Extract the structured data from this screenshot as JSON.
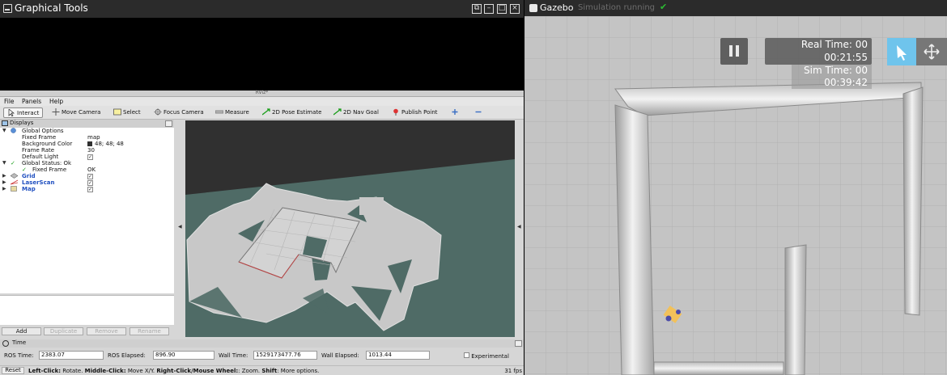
{
  "left_window": {
    "title": "Graphical Tools",
    "controls": {
      "restore": "⧉",
      "minimize": "–",
      "maximize": "□",
      "close": "×"
    }
  },
  "rviz": {
    "title": "RViz*",
    "menu": [
      "File",
      "Panels",
      "Help"
    ],
    "toolbar": [
      {
        "label": "Interact",
        "icon": "cursor-icon"
      },
      {
        "label": "Move Camera",
        "icon": "move-camera-icon"
      },
      {
        "label": "Select",
        "icon": "select-icon"
      },
      {
        "label": "Focus Camera",
        "icon": "focus-icon"
      },
      {
        "label": "Measure",
        "icon": "ruler-icon"
      },
      {
        "label": "2D Pose Estimate",
        "icon": "green-arrow-icon"
      },
      {
        "label": "2D Nav Goal",
        "icon": "green-arrow-icon"
      },
      {
        "label": "Publish Point",
        "icon": "pin-icon"
      }
    ],
    "displays": {
      "header": "Displays",
      "rows": {
        "global_options": "Global Options",
        "fixed_frame_key": "Fixed Frame",
        "fixed_frame_val": "map",
        "bg_color_key": "Background Color",
        "bg_color_val": "48; 48; 48",
        "frame_rate_key": "Frame Rate",
        "frame_rate_val": "30",
        "default_light_key": "Default Light",
        "global_status": "Global Status: Ok",
        "status_fixed_frame_key": "Fixed Frame",
        "status_fixed_frame_val": "OK",
        "grid": "Grid",
        "laserscan": "LaserScan",
        "map": "Map"
      },
      "buttons": {
        "add": "Add",
        "duplicate": "Duplicate",
        "remove": "Remove",
        "rename": "Rename"
      }
    },
    "time": {
      "header": "Time",
      "ros_time_label": "ROS Time:",
      "ros_time": "2383.07",
      "ros_elapsed_label": "ROS Elapsed:",
      "ros_elapsed": "896.90",
      "wall_time_label": "Wall Time:",
      "wall_time": "1529173477.76",
      "wall_elapsed_label": "Wall Elapsed:",
      "wall_elapsed": "1013.44",
      "experimental": "Experimental"
    },
    "status": {
      "reset": "Reset",
      "hint_1": "Left-Click:",
      "hint_1_text": " Rotate. ",
      "hint_2": "Middle-Click:",
      "hint_2_text": " Move X/Y. ",
      "hint_3": "Right-Click/Mouse Wheel:",
      "hint_3_text": ": Zoom. ",
      "hint_4": "Shift",
      "hint_4_text": ": More options.",
      "fps": "31 fps"
    },
    "colors": {
      "bg": "#303030",
      "ground": "#4f6b66",
      "map_free": "#c8c8c8"
    }
  },
  "gazebo": {
    "title": "Gazebo",
    "status": "Simulation running",
    "real_time_label": "Real Time: 00",
    "real_time": "00:21:55",
    "sim_time_label": "Sim Time: 00",
    "sim_time": "00:39:42",
    "colors": {
      "select_tool": "#6fc4ec",
      "ground": "#c4c4c4"
    }
  }
}
